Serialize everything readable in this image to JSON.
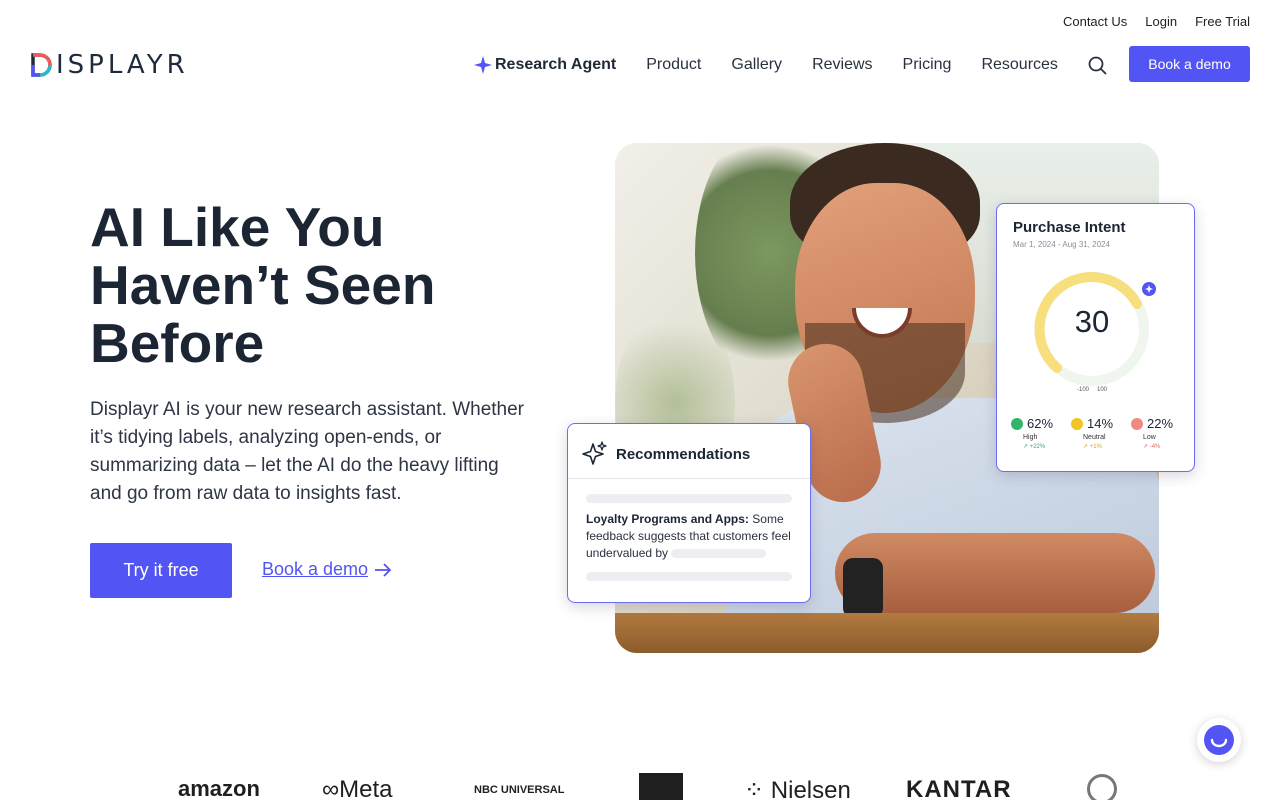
{
  "topbar": {
    "contact": "Contact Us",
    "login": "Login",
    "trial": "Free Trial"
  },
  "brand": {
    "name": "DISPLAYR",
    "colors": [
      "#f05a5b",
      "#2fb6c6",
      "#5354f4",
      "#1f2a3c"
    ]
  },
  "nav": {
    "items": [
      "Research Agent",
      "Product",
      "Gallery",
      "Reviews",
      "Pricing",
      "Resources"
    ],
    "cta": "Book a demo"
  },
  "hero": {
    "title_lines": [
      "AI Like You",
      "Haven’t Seen",
      "Before"
    ],
    "subtitle": "Displayr AI is your new research assistant. Whether it’s tidying labels, analyzing open-ends, or summarizing data – let the AI do the heavy lifting and go from raw data to insights fast.",
    "primary_cta": "Try it free",
    "secondary_cta": "Book a demo"
  },
  "purchase_intent": {
    "title": "Purchase Intent",
    "date_range": "Mar 1, 2024 - Aug 31, 2024",
    "score": "30",
    "min": "-100",
    "max": "100",
    "stats": [
      {
        "pct": "62%",
        "label": "High",
        "change": "↗ +22%",
        "color": "#34b36a",
        "change_color": "#34b36a"
      },
      {
        "pct": "14%",
        "label": "Neutral",
        "change": "↗ +1%",
        "color": "#f2c425",
        "change_color": "#e0a800"
      },
      {
        "pct": "22%",
        "label": "Low",
        "change": "↗ -4%",
        "color": "#ef8a82",
        "change_color": "#e06a60"
      }
    ]
  },
  "recommendations": {
    "title": "Recommendations",
    "lead": "Loyalty Programs and Apps:",
    "text": "Some feedback suggests that customers feel undervalued by"
  },
  "logos": [
    "amazon",
    "Meta",
    "NBC UNIVERSAL",
    "Nielsen",
    "KANTAR"
  ],
  "accent": "#5354f4"
}
